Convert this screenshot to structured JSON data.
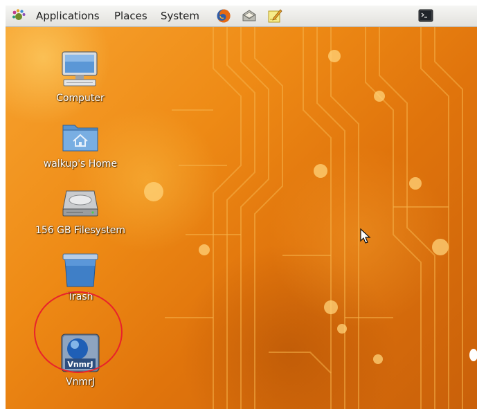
{
  "panel": {
    "menus": [
      "Applications",
      "Places",
      "System"
    ],
    "launchers": [
      "firefox-icon",
      "mail-icon",
      "text-editor-icon"
    ],
    "tray": [
      "terminal-icon"
    ]
  },
  "desktop": {
    "icons": [
      {
        "label": "Computer",
        "icon": "computer-icon"
      },
      {
        "label": "walkup's Home",
        "icon": "home-folder-icon"
      },
      {
        "label": "156 GB Filesystem",
        "icon": "hard-drive-icon"
      },
      {
        "label": "Trash",
        "icon": "trash-icon"
      },
      {
        "label": "VnmrJ",
        "icon": "vnmrj-app-icon",
        "logo_text": "VnmrJ"
      }
    ]
  },
  "colors": {
    "panel_bg": "#ebeae7",
    "desktop_orange": "#ee8a15",
    "highlight_circle": "#e8222b"
  }
}
